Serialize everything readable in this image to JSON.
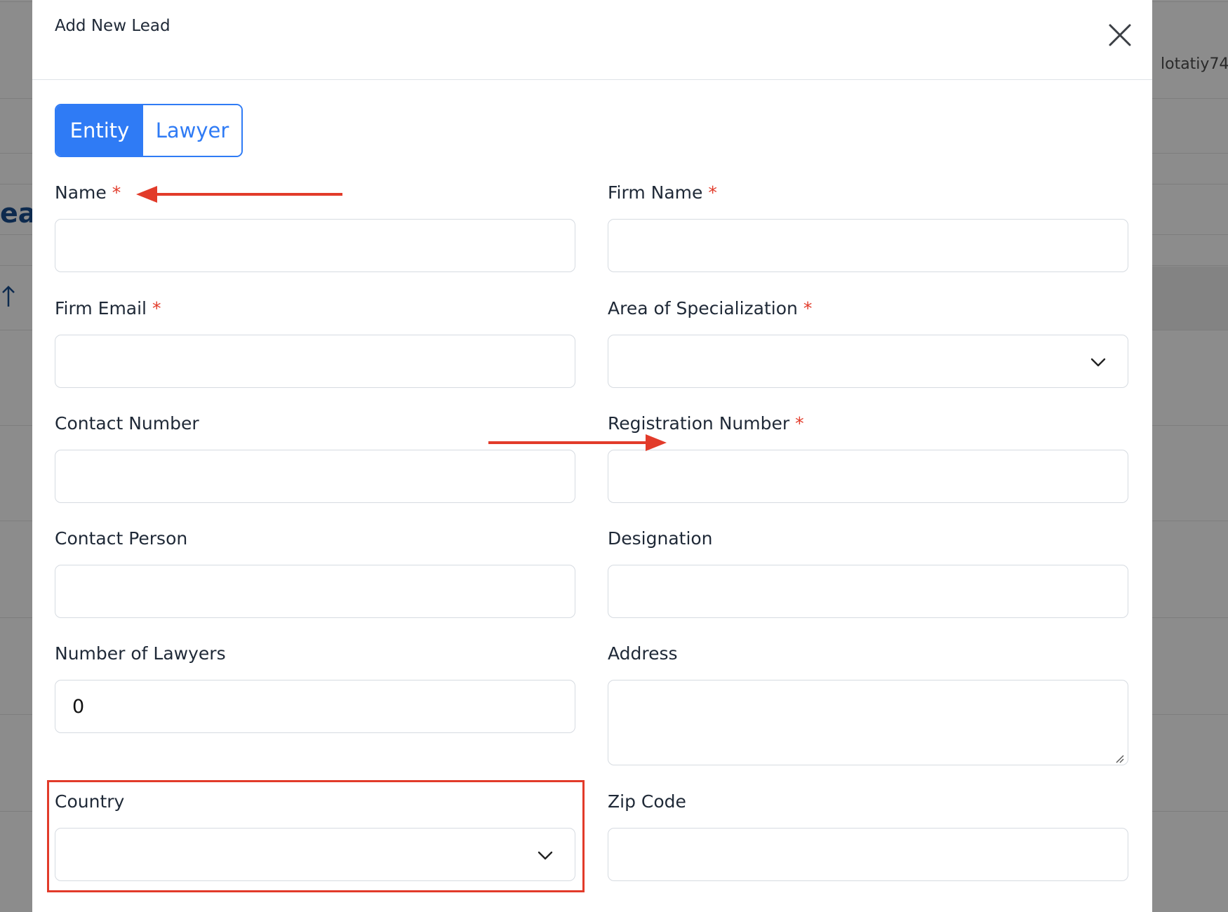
{
  "background": {
    "user_label": "lotatiy74",
    "heading_fragment": "ea",
    "sort_icon": "sort-arrow-icon"
  },
  "modal": {
    "title": "Add New Lead",
    "close_icon": "close-icon",
    "toggle": {
      "options": [
        "Entity",
        "Lawyer"
      ],
      "selected": "Entity"
    },
    "fields": {
      "name": {
        "label": "Name",
        "required_mark": "*",
        "value": ""
      },
      "firm_name": {
        "label": "Firm Name",
        "required_mark": "*",
        "value": ""
      },
      "firm_email": {
        "label": "Firm Email",
        "required_mark": "*",
        "value": ""
      },
      "area_of_specialization": {
        "label": "Area of Specialization",
        "required_mark": "*",
        "selected": ""
      },
      "contact_number": {
        "label": "Contact Number",
        "value": ""
      },
      "registration_number": {
        "label": "Registration Number",
        "required_mark": "*",
        "value": ""
      },
      "contact_person": {
        "label": "Contact Person",
        "value": ""
      },
      "designation": {
        "label": "Designation",
        "value": ""
      },
      "number_of_lawyers": {
        "label": "Number of Lawyers",
        "value": "0"
      },
      "address": {
        "label": "Address",
        "value": ""
      },
      "country": {
        "label": "Country",
        "selected": ""
      },
      "zip_code": {
        "label": "Zip Code",
        "value": ""
      }
    }
  },
  "annotations": {
    "color": "#e23b2a",
    "arrow_icon": "arrow-icon",
    "highlight": "country"
  },
  "colors": {
    "accent": "#2f7bf5",
    "required": "#e23b2a",
    "border": "#d6dbe1",
    "overlay": "#8c8c8c"
  }
}
